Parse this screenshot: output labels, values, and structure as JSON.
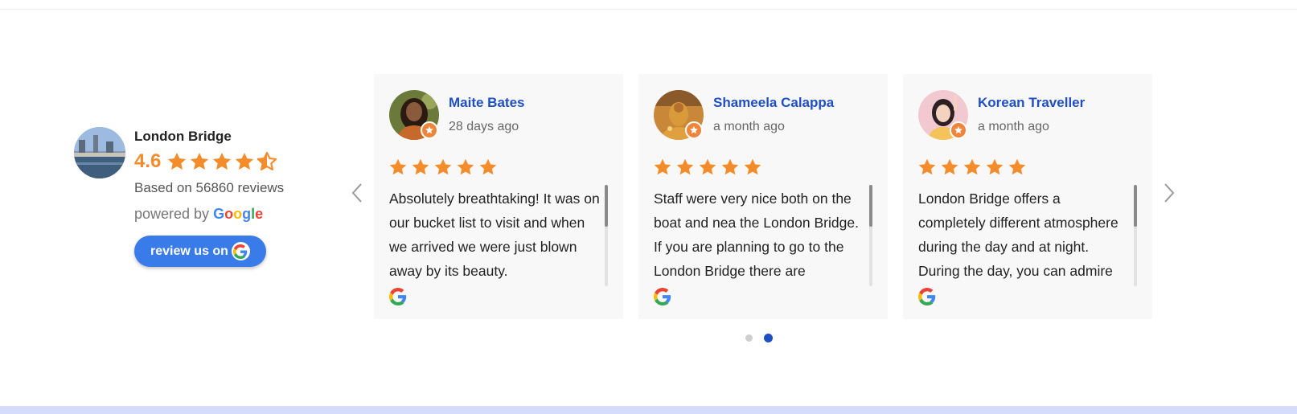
{
  "summary": {
    "place_name": "London Bridge",
    "rating": "4.6",
    "rating_value": 4.6,
    "based_on": "Based on 56860 reviews",
    "powered_by": "powered by",
    "google_letters": [
      "G",
      "o",
      "o",
      "g",
      "l",
      "e"
    ],
    "google_colors": [
      "#4285F4",
      "#EA4335",
      "#FBBC05",
      "#4285F4",
      "#34A853",
      "#EA4335"
    ],
    "review_button": "review us on"
  },
  "reviews": [
    {
      "name": "Maite Bates",
      "date": "28 days ago",
      "stars": 5,
      "text": "Absolutely breathtaking! It was on our bucket list to visit and when we arrived we were just blown away by its beauty."
    },
    {
      "name": "Shameela Calappa",
      "date": "a month ago",
      "stars": 5,
      "text": "Staff were very nice both on the boat and nea the London Bridge. If you are planning to go to the London Bridge there are"
    },
    {
      "name": "Korean Traveller",
      "date": "a month ago",
      "stars": 5,
      "text": "London Bridge offers a completely different atmosphere during the day and at night. During the day, you can admire"
    }
  ],
  "pagination": {
    "pages": 2,
    "active_page": 2
  },
  "icons": {
    "prev": "chevron-left-icon",
    "next": "chevron-right-icon",
    "star": "star-icon",
    "google": "google-g-icon",
    "local_guide": "local-guide-badge-icon"
  },
  "colors": {
    "star": "#f58c2b",
    "name_link": "#1f4fc4",
    "button": "#3a7bea",
    "dot_active": "#1d4fc0"
  }
}
